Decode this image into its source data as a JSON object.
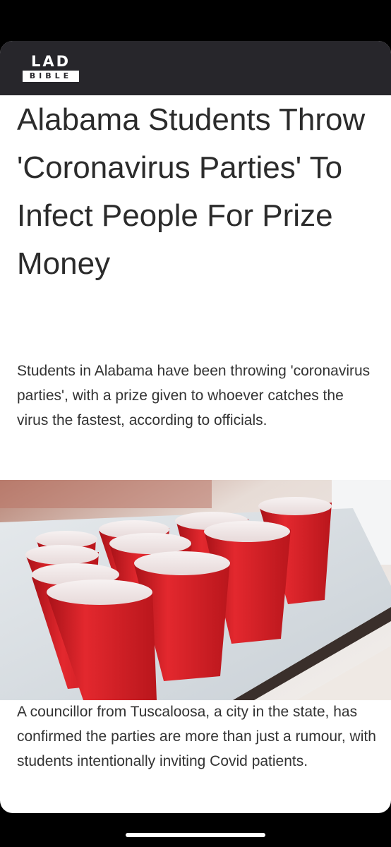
{
  "header": {
    "logo_top": "LAD",
    "logo_bottom": "BIBLE",
    "background": "#27262b"
  },
  "article": {
    "headline": "Alabama Students Throw 'Coronavirus Parties' To Infect People For Prize Money",
    "standfirst": "Students in Alabama have been throwing 'coronavirus parties', with a prize given to whoever catches the virus the fastest, according to officials.",
    "body": "A councillor from Tuscaloosa, a city in the state, has confirmed the parties are more than just a rumour, with students intentionally inviting Covid patients."
  },
  "image": {
    "subject": "red party cups on a table",
    "cup_color": "#d8232a"
  }
}
